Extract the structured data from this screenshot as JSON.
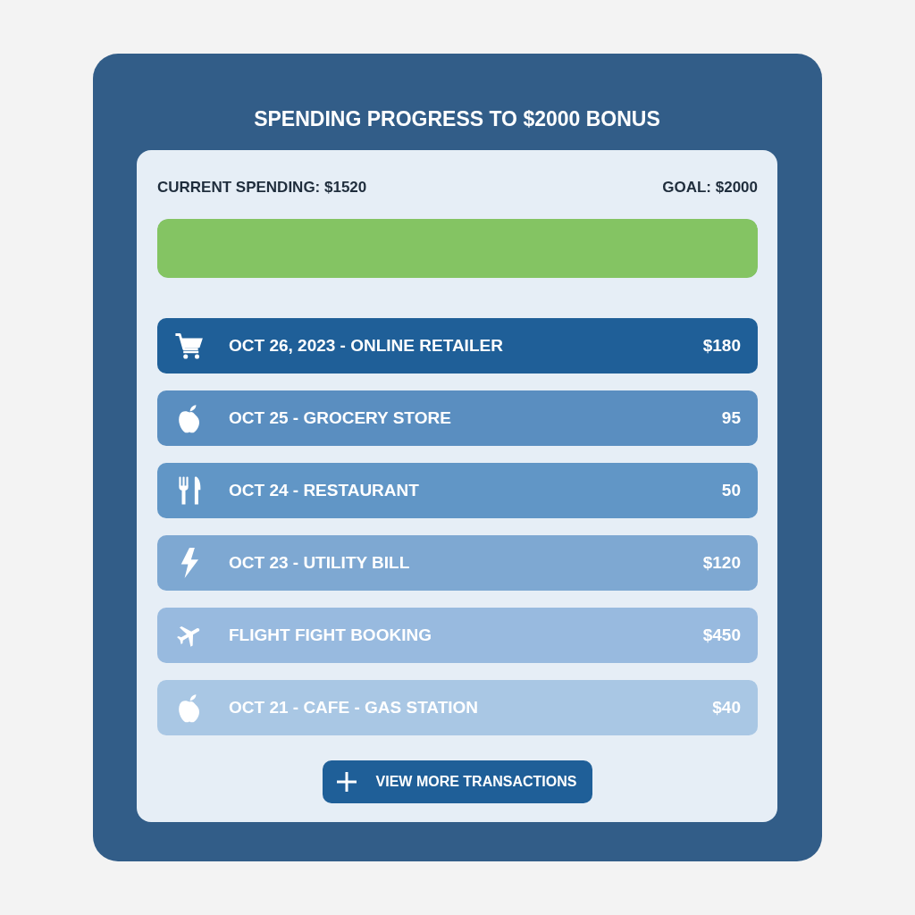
{
  "title": "SPENDING PROGRESS TO $2000 BONUS",
  "progress": {
    "current_label": "CURRENT SPENDING: $1520",
    "goal_label": "GOAL: $2000",
    "level": 1
  },
  "transactions": [
    {
      "kind": "cart",
      "label": "OCT 26, 2023 - ONLINE RETAILER",
      "amount": "$180",
      "color": "#1f5f98"
    },
    {
      "kind": "apple",
      "label": "OCT 25 - GROCERY STORE",
      "amount": "95",
      "color": "#5a8ec0"
    },
    {
      "kind": "cutlery",
      "label": "OCT 24 - RESTAURANT",
      "amount": "50",
      "color": "#6196c6"
    },
    {
      "kind": "bolt",
      "label": "OCT 23 - UTILITY BILL",
      "amount": "$120",
      "color": "#7ea8d2"
    },
    {
      "kind": "plane",
      "label": "FLIGHT FIGHT BOOKING",
      "amount": "$450",
      "color": "#98badf"
    },
    {
      "kind": "apple",
      "label": "OCT 21 - CAFE - GAS STATION",
      "amount": "$40",
      "color": "#a9c7e4"
    }
  ],
  "button": {
    "label": "VIEW MORE TRANSACTIONS"
  }
}
